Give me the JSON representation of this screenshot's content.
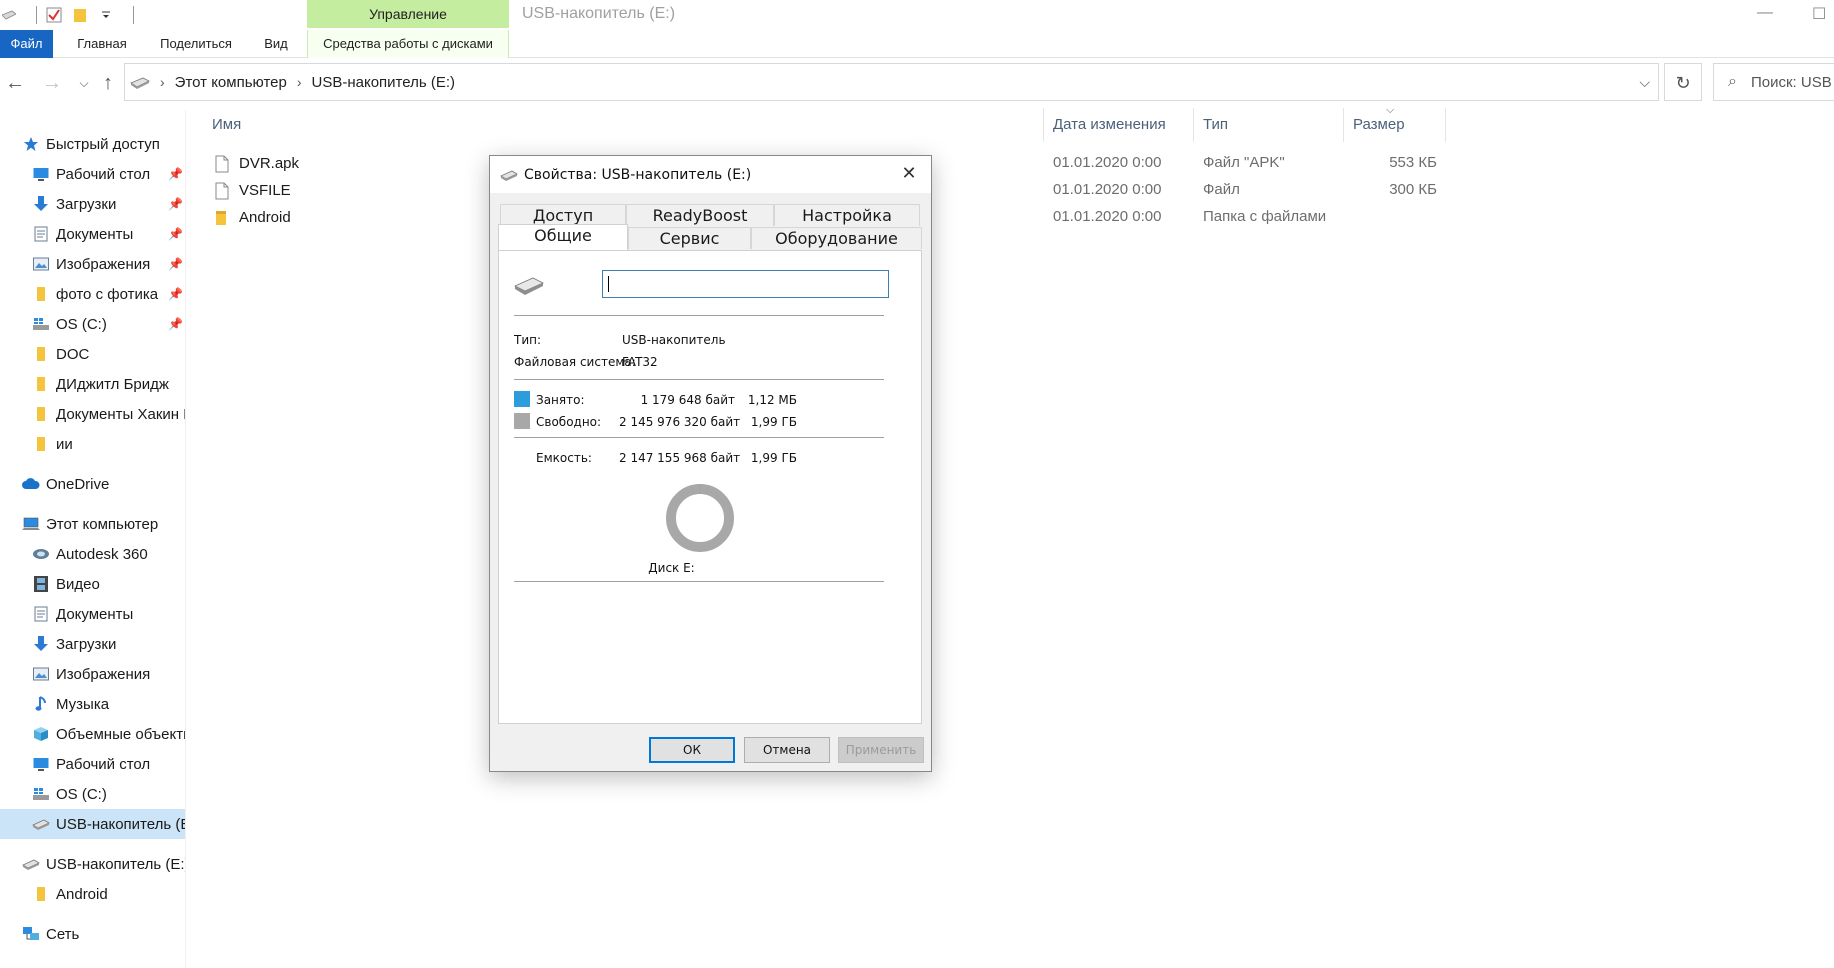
{
  "window": {
    "title": "USB-накопитель (E:)",
    "manage_tab": "Управление",
    "minimize": "—",
    "maximize": "☐"
  },
  "ribbon": {
    "tabs": [
      "Файл",
      "Главная",
      "Поделиться",
      "Вид",
      "Средства работы с дисками"
    ]
  },
  "address": {
    "crumbs": [
      "Этот компьютер",
      "USB-накопитель (E:)"
    ],
    "search_placeholder": "Поиск: USB"
  },
  "sidebar": {
    "quick_access": "Быстрый доступ",
    "quick_items": [
      "Рабочий стол",
      "Загрузки",
      "Документы",
      "Изображения",
      "фото с фотика",
      "OS (C:)",
      "DOC",
      "ДИджитл Бридж",
      "Документы Хакин Б",
      "ии"
    ],
    "onedrive": "OneDrive",
    "this_pc": "Этот компьютер",
    "pc_items": [
      "Autodesk 360",
      "Видео",
      "Документы",
      "Загрузки",
      "Изображения",
      "Музыка",
      "Объемные объекты",
      "Рабочий стол",
      "OS (C:)",
      "USB-накопитель (E:)"
    ],
    "usb_root": "USB-накопитель (E:)",
    "usb_items": [
      "Android"
    ],
    "network": "Сеть"
  },
  "filelist": {
    "columns": [
      "Имя",
      "Дата изменения",
      "Тип",
      "Размер"
    ],
    "rows": [
      {
        "name": "DVR.apk",
        "date": "01.01.2020 0:00",
        "type": "Файл \"APK\"",
        "size": "553 КБ"
      },
      {
        "name": "VSFILE",
        "date": "01.01.2020 0:00",
        "type": "Файл",
        "size": "300 КБ"
      },
      {
        "name": "Android",
        "date": "01.01.2020 0:00",
        "type": "Папка с файлами",
        "size": ""
      }
    ]
  },
  "dialog": {
    "title": "Свойства: USB-накопитель (E:)",
    "tabs_back": [
      "Доступ",
      "ReadyBoost",
      "Настройка"
    ],
    "tabs_front": [
      "Общие",
      "Сервис",
      "Оборудование"
    ],
    "label_value": "",
    "type_label": "Тип:",
    "type_value": "USB-накопитель",
    "fs_label": "Файловая система:",
    "fs_value": "FAT32",
    "used_label": "Занято:",
    "used_bytes": "1 179 648 байт",
    "used_human": "1,12 МБ",
    "free_label": "Свободно:",
    "free_bytes": "2 145 976 320 байт",
    "free_human": "1,99 ГБ",
    "capacity_label": "Емкость:",
    "capacity_bytes": "2 147 155 968 байт",
    "capacity_human": "1,99 ГБ",
    "disk_caption": "Диск E:",
    "used_fraction": 0.00055,
    "used_color": "#2d9cdb",
    "free_color": "#a8a8a8",
    "btn_ok": "ОК",
    "btn_cancel": "Отмена",
    "btn_apply": "Применить"
  }
}
